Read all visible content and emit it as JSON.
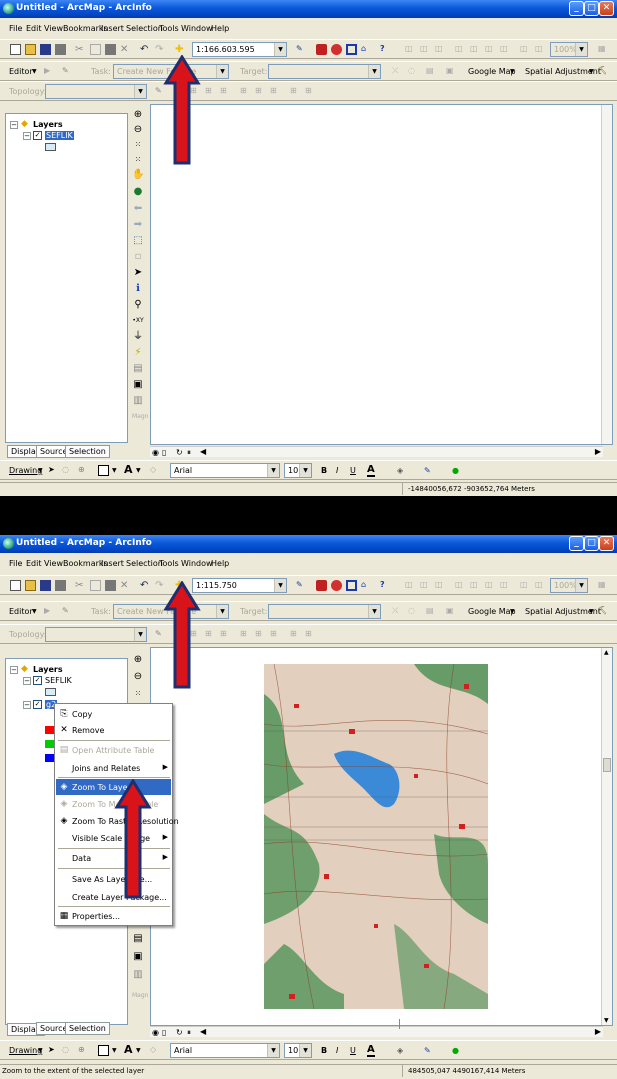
{
  "window": {
    "title": "Untitled - ArcMap - ArcInfo"
  },
  "menu": [
    "File",
    "Edit",
    "View",
    "Bookmarks",
    "Insert",
    "Selection",
    "Tools",
    "Window",
    "Help"
  ],
  "toolbar": {
    "scale_top": "1:166.603.595",
    "scale_bottom": "1:115.750",
    "zoom_pct": "100%",
    "editor": "Editor",
    "task_label": "Task:",
    "task_value": "Create New Feature",
    "target_label": "Target:",
    "google_map": "Google Map",
    "spatial_adjustment": "Spatial Adjustment",
    "topology": "Topology:"
  },
  "toc": {
    "root": "Layers",
    "layer1": "SEFLIK",
    "layer2": "g2"
  },
  "tabs": {
    "display": "Display",
    "source": "Source",
    "selection": "Selection"
  },
  "drawing": {
    "label": "Drawing",
    "font": "Arial",
    "size": "10",
    "bold": "B",
    "italic": "I",
    "underline": "U",
    "text_tool": "A"
  },
  "status": {
    "top_message": "",
    "top_coords": "-14840056,672 -903652,764 Meters",
    "bottom_message": "Zoom to the extent of the selected layer",
    "bottom_coords": "484505,047 4490167,414 Meters"
  },
  "context_menu": {
    "copy": "Copy",
    "remove": "Remove",
    "open_attr": "Open Attribute Table",
    "joins": "Joins and Relates",
    "zoom_layer": "Zoom To Layer",
    "zoom_make": "Zoom To Make Visible",
    "zoom_raster": "Zoom To Raster Resolution",
    "visible_scale": "Visible Scale Range",
    "data": "Data",
    "save_as": "Save As Layer File...",
    "create_pkg": "Create Layer Package...",
    "properties": "Properties..."
  },
  "colors": {
    "arrow_fill": "#d8141a",
    "arrow_outline": "#1e2e6e",
    "highlight": "#316ac5",
    "titlebar": "#0a58d8",
    "swatch1": "#d6ecf8",
    "red": "#ff0000",
    "green": "#00cc00",
    "blue": "#0000ff"
  }
}
